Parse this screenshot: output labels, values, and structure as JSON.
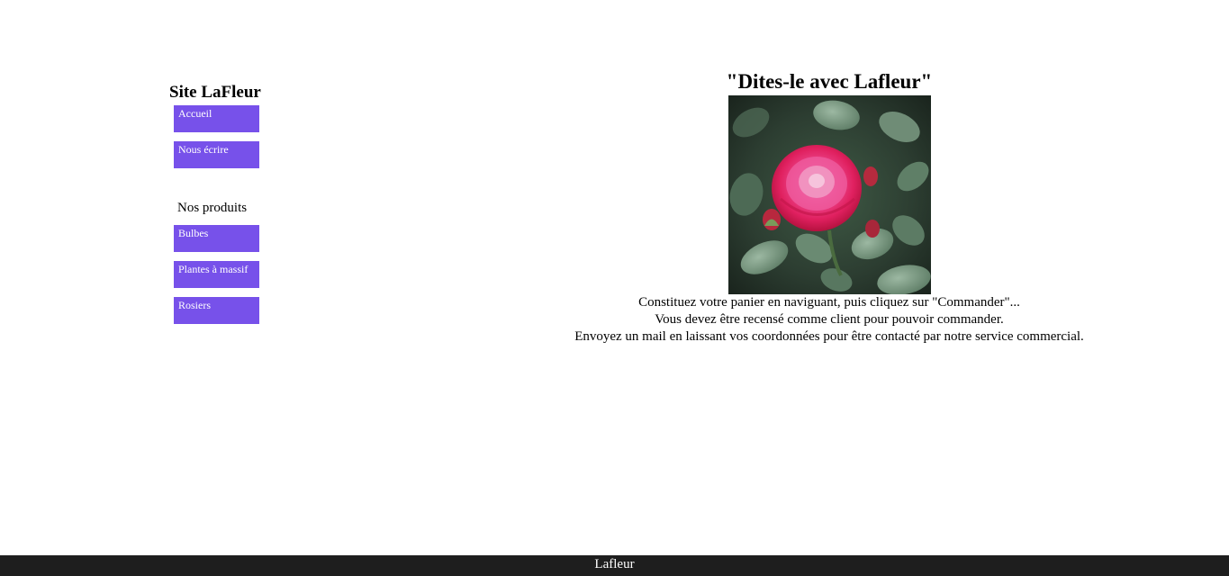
{
  "sidebar": {
    "title": "Site LaFleur",
    "menu": {
      "accueil": "Accueil",
      "ecrire": "Nous écrire"
    },
    "products_heading": "Nos produits",
    "products": {
      "bulbes": "Bulbes",
      "massif": "Plantes à massif",
      "rosiers": "Rosiers"
    },
    "button_color": "#7751ea"
  },
  "main": {
    "slogan": "\"Dites-le avec Lafleur\"",
    "image": "pink-rose-photo",
    "lines": [
      "Constituez votre panier en naviguant, puis cliquez sur \"Commander\"...",
      "Vous devez être recensé comme client pour pouvoir commander.",
      "Envoyez un mail en laissant vos coordonnées pour être contacté par notre service commercial."
    ]
  },
  "footer": {
    "text": "Lafleur",
    "background": "#1e1e1e"
  }
}
